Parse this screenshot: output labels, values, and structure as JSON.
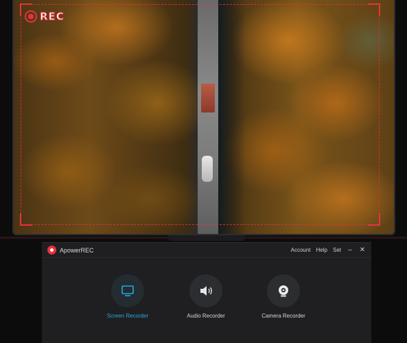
{
  "preview": {
    "rec_label": "REC"
  },
  "app": {
    "title": "ApowerREC",
    "menu": {
      "account": "Account",
      "help": "Help",
      "settings": "Set"
    },
    "window_controls": {
      "minimize": "–",
      "close": "✕"
    },
    "modes": [
      {
        "label": "Screen Recorder",
        "icon": "monitor-icon",
        "active": true
      },
      {
        "label": "Audio Recorder",
        "icon": "speaker-icon",
        "active": false
      },
      {
        "label": "Camera Recorder",
        "icon": "camera-icon",
        "active": false
      }
    ]
  },
  "colors": {
    "accent": "#2aa7e0",
    "rec_red": "#e8323c",
    "window_bg": "#1f1f21"
  }
}
